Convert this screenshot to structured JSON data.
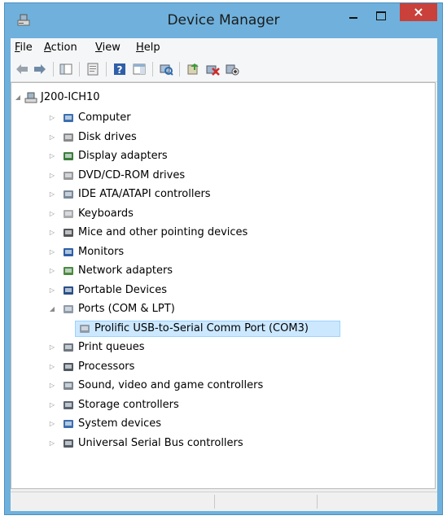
{
  "window": {
    "title": "Device Manager",
    "close_glyph": "×"
  },
  "menu": {
    "file": "F",
    "file_rest": "ile",
    "action": "A",
    "action_rest": "ction",
    "view": "V",
    "view_rest": "iew",
    "help": "H",
    "help_rest": "elp"
  },
  "toolbar": {
    "icons": [
      "back-arrow-icon",
      "forward-arrow-icon",
      "show-hide-console-tree-icon",
      "properties-icon",
      "help-icon",
      "action-pane-icon",
      "scan-hardware-icon",
      "update-driver-icon",
      "uninstall-device-icon",
      "disable-device-icon"
    ]
  },
  "tree": {
    "root": "J200-ICH10",
    "items": [
      {
        "label": "Computer",
        "icon": "computer-icon",
        "expanded": false
      },
      {
        "label": "Disk drives",
        "icon": "disk-drive-icon",
        "expanded": false
      },
      {
        "label": "Display adapters",
        "icon": "display-adapter-icon",
        "expanded": false
      },
      {
        "label": "DVD/CD-ROM drives",
        "icon": "dvd-drive-icon",
        "expanded": false
      },
      {
        "label": "IDE ATA/ATAPI controllers",
        "icon": "ide-controller-icon",
        "expanded": false
      },
      {
        "label": "Keyboards",
        "icon": "keyboard-icon",
        "expanded": false
      },
      {
        "label": "Mice and other pointing devices",
        "icon": "mouse-icon",
        "expanded": false
      },
      {
        "label": "Monitors",
        "icon": "monitor-icon",
        "expanded": false
      },
      {
        "label": "Network adapters",
        "icon": "network-adapter-icon",
        "expanded": false
      },
      {
        "label": "Portable Devices",
        "icon": "portable-device-icon",
        "expanded": false
      },
      {
        "label": "Ports (COM & LPT)",
        "icon": "port-icon",
        "expanded": true
      },
      {
        "label": "Prolific USB-to-Serial Comm Port (COM3)",
        "icon": "port-icon",
        "child": true,
        "selected": true
      },
      {
        "label": "Print queues",
        "icon": "printer-icon",
        "expanded": false
      },
      {
        "label": "Processors",
        "icon": "processor-icon",
        "expanded": false
      },
      {
        "label": "Sound, video and game controllers",
        "icon": "speaker-icon",
        "expanded": false
      },
      {
        "label": "Storage controllers",
        "icon": "storage-controller-icon",
        "expanded": false
      },
      {
        "label": "System devices",
        "icon": "system-device-icon",
        "expanded": false
      },
      {
        "label": "Universal Serial Bus controllers",
        "icon": "usb-icon",
        "expanded": false
      }
    ]
  },
  "colors": {
    "titlebar": "#6fb1dc",
    "close": "#c9413a",
    "selection": "#cce8ff"
  }
}
